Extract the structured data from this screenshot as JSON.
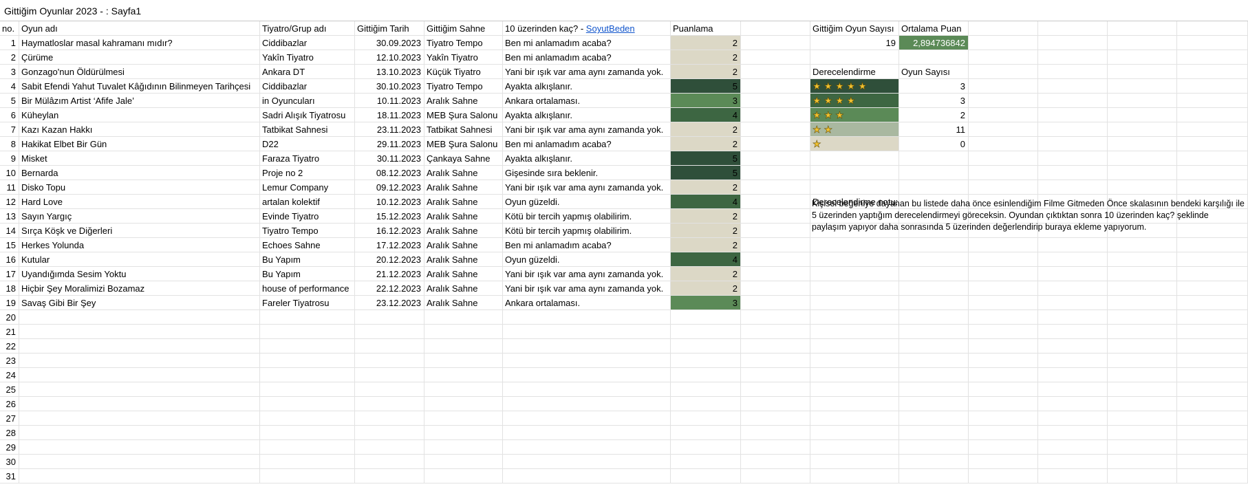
{
  "window_title": "Gittiğim Oyunlar 2023 - : Sayfa1",
  "headers": {
    "no": "no.",
    "name": "Oyun adı",
    "group": "Tiyatro/Grup adı",
    "date": "Gittiğim Tarih",
    "venue": "Gittiğim Sahne",
    "comment_prefix": "10 üzerinden kaç? - ",
    "comment_link": "SoyutBeden",
    "rating": "Puanlama"
  },
  "rows": [
    {
      "no": "1",
      "name": "Haymatloslar masal kahramanı mıdır?",
      "group": "Ciddibazlar",
      "date": "30.09.2023",
      "venue": "Tiyatro Tempo",
      "comment": "Ben mi anlamadım acaba?",
      "rating": 2
    },
    {
      "no": "2",
      "name": "Çürüme",
      "group": "Yakîn Tiyatro",
      "date": "12.10.2023",
      "venue": "Yakîn Tiyatro",
      "comment": "Ben mi anlamadım acaba?",
      "rating": 2
    },
    {
      "no": "3",
      "name": "Gonzago'nun Öldürülmesi",
      "group": "Ankara DT",
      "date": "13.10.2023",
      "venue": "Küçük Tiyatro",
      "comment": "Yani bir ışık var ama aynı zamanda yok.",
      "rating": 2
    },
    {
      "no": "4",
      "name": "Sabit Efendi Yahut Tuvalet Kâğıdının Bilinmeyen Tarihçesi",
      "group": "Ciddibazlar",
      "date": "30.10.2023",
      "venue": "Tiyatro Tempo",
      "comment": "Ayakta alkışlanır.",
      "rating": 5
    },
    {
      "no": "5",
      "name": "Bir Mülâzım Artist ‘Afife Jale’",
      "group": "in Oyuncuları",
      "date": "10.11.2023",
      "venue": "Aralık Sahne",
      "comment": "Ankara ortalaması.",
      "rating": 3
    },
    {
      "no": "6",
      "name": "Küheylan",
      "group": "Sadri Alışık Tiyatrosu",
      "date": "18.11.2023",
      "venue": "MEB Şura Salonu",
      "comment": "Ayakta alkışlanır.",
      "rating": 4
    },
    {
      "no": "7",
      "name": "Kazı Kazan Hakkı",
      "group": "Tatbikat Sahnesi",
      "date": "23.11.2023",
      "venue": "Tatbikat Sahnesi",
      "comment": "Yani bir ışık var ama aynı zamanda yok.",
      "rating": 2
    },
    {
      "no": "8",
      "name": "Hakikat Elbet Bir Gün",
      "group": "D22",
      "date": "29.11.2023",
      "venue": "MEB Şura Salonu",
      "comment": "Ben mi anlamadım acaba?",
      "rating": 2
    },
    {
      "no": "9",
      "name": "Misket",
      "group": "Faraza Tiyatro",
      "date": "30.11.2023",
      "venue": "Çankaya Sahne",
      "comment": "Ayakta alkışlanır.",
      "rating": 5
    },
    {
      "no": "10",
      "name": "Bernarda",
      "group": "Proje no 2",
      "date": "08.12.2023",
      "venue": "Aralık Sahne",
      "comment": "Gişesinde sıra beklenir.",
      "rating": 5
    },
    {
      "no": "11",
      "name": "Disko Topu",
      "group": "Lemur Company",
      "date": "09.12.2023",
      "venue": "Aralık Sahne",
      "comment": "Yani bir ışık var ama aynı zamanda yok.",
      "rating": 2
    },
    {
      "no": "12",
      "name": "Hard Love",
      "group": "artalan kolektif",
      "date": "10.12.2023",
      "venue": "Aralık Sahne",
      "comment": "Oyun güzeldi.",
      "rating": 4
    },
    {
      "no": "13",
      "name": "Sayın Yargıç",
      "group": "Evinde Tiyatro",
      "date": "15.12.2023",
      "venue": "Aralık Sahne",
      "comment": "Kötü bir tercih yapmış olabilirim.",
      "rating": 2
    },
    {
      "no": "14",
      "name": "Sırça Köşk ve Diğerleri",
      "group": "Tiyatro Tempo",
      "date": "16.12.2023",
      "venue": "Aralık Sahne",
      "comment": "Kötü bir tercih yapmış olabilirim.",
      "rating": 2
    },
    {
      "no": "15",
      "name": "Herkes Yolunda",
      "group": "Echoes Sahne",
      "date": "17.12.2023",
      "venue": "Aralık Sahne",
      "comment": "Ben mi anlamadım acaba?",
      "rating": 2
    },
    {
      "no": "16",
      "name": "Kutular",
      "group": "Bu Yapım",
      "date": "20.12.2023",
      "venue": "Aralık Sahne",
      "comment": "Oyun güzeldi.",
      "rating": 4
    },
    {
      "no": "17",
      "name": "Uyandığımda Sesim Yoktu",
      "group": "Bu Yapım",
      "date": "21.12.2023",
      "venue": "Aralık Sahne",
      "comment": "Yani bir ışık var ama aynı zamanda yok.",
      "rating": 2
    },
    {
      "no": "18",
      "name": "Hiçbir Şey Moralimizi Bozamaz",
      "group": "house of performance",
      "date": "22.12.2023",
      "venue": "Aralık Sahne",
      "comment": "Yani bir ışık var ama aynı zamanda yok.",
      "rating": 2
    },
    {
      "no": "19",
      "name": "Savaş Gibi Bir Şey",
      "group": "Fareler Tiyatrosu",
      "date": "23.12.2023",
      "venue": "Aralık Sahne",
      "comment": "Ankara ortalaması.",
      "rating": 3
    }
  ],
  "empty_rows": [
    "20",
    "21",
    "22",
    "23",
    "24",
    "25",
    "26",
    "27",
    "28",
    "29",
    "30",
    "31"
  ],
  "summary": {
    "count_label": "Gittiğim Oyun Sayısı",
    "avg_label": "Ortalama Puan",
    "count_value": "19",
    "avg_value": "2,894736842",
    "rating_label": "Derecelendirme",
    "play_count_label": "Oyun Sayısı",
    "ratings": [
      {
        "stars": "★★★★★",
        "count": "3",
        "color": "#2f4f3a"
      },
      {
        "stars": "★★★★",
        "count": "3",
        "color": "#3d6642"
      },
      {
        "stars": "★★★",
        "count": "2",
        "color": "#5b8a57"
      },
      {
        "stars": "★★",
        "count": "11",
        "color": "#a9b8a0"
      },
      {
        "stars": "★",
        "count": "0",
        "color": "#dcd8c6"
      }
    ],
    "note_label": "Derecelendirme notu:",
    "note_text": "Kişisel beğeniye dayanan bu listede daha önce esinlendiğim Filme Gitmeden Önce skalasının bendeki karşılığı ile 5 üzerinden yaptığım derecelendirmeyi göreceksin. Oyundan çıktıktan sonra 10 üzerinden kaç? şeklinde paylaşım yapıyor daha sonrasında 5 üzerinden değerlendirip buraya ekleme yapıyorum."
  },
  "rating_colors": {
    "2": "#dcd8c6",
    "3": "#5b8a57",
    "4": "#3d6642",
    "5": "#2f4f3a"
  }
}
